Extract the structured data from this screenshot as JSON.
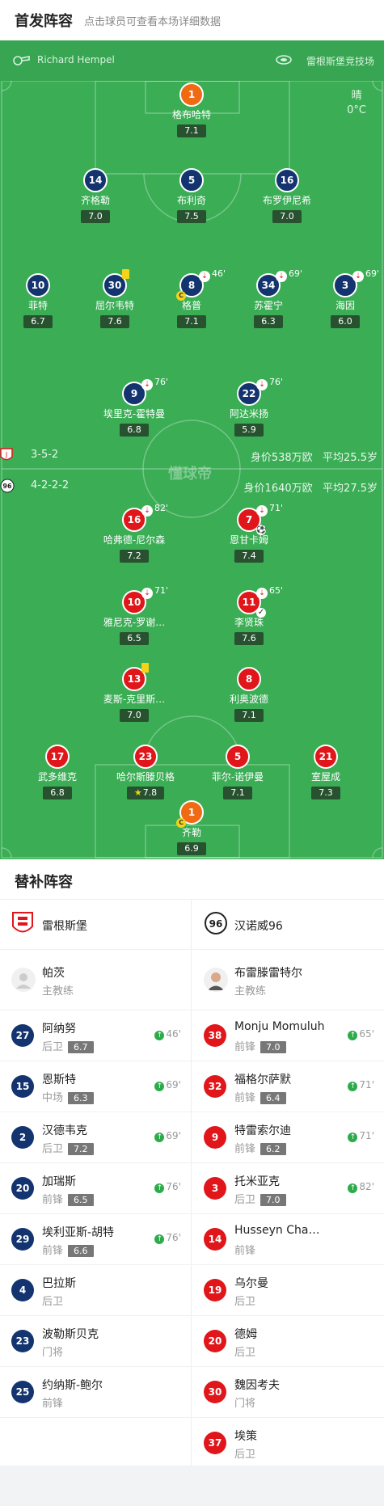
{
  "header": {
    "title": "首发阵容",
    "subtitle": "点击球员可查看本场详细数据"
  },
  "match": {
    "referee": "Richard Hempel",
    "venue": "雷根斯堡竞技场",
    "weather": "晴",
    "temperature": "0°C",
    "watermark": "懂球帝"
  },
  "home": {
    "formation": "3-5-2",
    "value": "身价538万欧",
    "avg_age": "平均25.5岁"
  },
  "away": {
    "formation": "4-2-2-2",
    "value": "身价1640万欧",
    "avg_age": "平均27.5岁"
  },
  "home_players": [
    {
      "num": "1",
      "name": "格布哈特",
      "rating": "7.1",
      "color": "orange"
    },
    {
      "num": "14",
      "name": "齐格勒",
      "rating": "7.0",
      "color": "blue"
    },
    {
      "num": "5",
      "name": "布利奇",
      "rating": "7.5",
      "color": "blue"
    },
    {
      "num": "16",
      "name": "布罗伊尼希",
      "rating": "7.0",
      "color": "blue"
    },
    {
      "num": "10",
      "name": "菲特",
      "rating": "6.7",
      "color": "blue"
    },
    {
      "num": "30",
      "name": "屈尔韦特",
      "rating": "7.6",
      "color": "blue",
      "yellow": true
    },
    {
      "num": "8",
      "name": "格普",
      "rating": "7.1",
      "color": "blue",
      "sub_out": "46'",
      "captain": "C"
    },
    {
      "num": "34",
      "name": "苏霍宁",
      "rating": "6.3",
      "color": "blue",
      "sub_out": "69'"
    },
    {
      "num": "3",
      "name": "海因",
      "rating": "6.0",
      "color": "blue",
      "sub_out": "69'"
    },
    {
      "num": "9",
      "name": "埃里克-霍特曼",
      "rating": "6.8",
      "color": "blue",
      "sub_out": "76'"
    },
    {
      "num": "22",
      "name": "阿达米扬",
      "rating": "5.9",
      "color": "blue",
      "sub_out": "76'"
    }
  ],
  "away_players": [
    {
      "num": "16",
      "name": "哈弗德-尼尔森",
      "rating": "7.2",
      "color": "red",
      "sub_out": "82'"
    },
    {
      "num": "7",
      "name": "恩甘卡姆",
      "rating": "7.4",
      "color": "red",
      "sub_out": "71'",
      "goal": true
    },
    {
      "num": "10",
      "name": "雅尼克-罗谢…",
      "rating": "6.5",
      "color": "red",
      "sub_out": "71'"
    },
    {
      "num": "11",
      "name": "李贤珠",
      "rating": "7.6",
      "color": "red",
      "sub_out": "65'",
      "assist": true
    },
    {
      "num": "13",
      "name": "麦斯-克里斯…",
      "rating": "7.0",
      "color": "red",
      "yellow": true
    },
    {
      "num": "8",
      "name": "利奥波德",
      "rating": "7.1",
      "color": "red"
    },
    {
      "num": "17",
      "name": "武多维克",
      "rating": "6.8",
      "color": "red"
    },
    {
      "num": "23",
      "name": "哈尔斯滕贝格",
      "rating": "7.8",
      "color": "red",
      "star": true
    },
    {
      "num": "5",
      "name": "菲尔-诺伊曼",
      "rating": "7.1",
      "color": "red"
    },
    {
      "num": "21",
      "name": "室屋成",
      "rating": "7.3",
      "color": "red"
    },
    {
      "num": "1",
      "name": "齐勒",
      "rating": "6.9",
      "color": "orange",
      "captain": "C"
    }
  ],
  "subs": {
    "title": "替补阵容",
    "home_team": "雷根斯堡",
    "away_team": "汉诺威96",
    "home_coach": {
      "name": "帕茨",
      "role": "主教练"
    },
    "away_coach": {
      "name": "布雷滕雷特尔",
      "role": "主教练"
    },
    "home": [
      {
        "num": "27",
        "name": "阿纳努",
        "pos": "后卫",
        "rating": "6.7",
        "time": "46'"
      },
      {
        "num": "15",
        "name": "恩斯特",
        "pos": "中场",
        "rating": "6.3",
        "time": "69'"
      },
      {
        "num": "2",
        "name": "汉德韦克",
        "pos": "后卫",
        "rating": "7.2",
        "time": "69'"
      },
      {
        "num": "20",
        "name": "加瑞斯",
        "pos": "前锋",
        "rating": "6.5",
        "time": "76'"
      },
      {
        "num": "29",
        "name": "埃利亚斯-胡特",
        "pos": "前锋",
        "rating": "6.6",
        "time": "76'"
      },
      {
        "num": "4",
        "name": "巴拉斯",
        "pos": "后卫"
      },
      {
        "num": "23",
        "name": "波勒斯贝克",
        "pos": "门将"
      },
      {
        "num": "25",
        "name": "约纳斯-鲍尔",
        "pos": "前锋"
      }
    ],
    "away": [
      {
        "num": "38",
        "name": "Monju Momuluh",
        "pos": "前锋",
        "rating": "7.0",
        "time": "65'"
      },
      {
        "num": "32",
        "name": "福格尔萨默",
        "pos": "前锋",
        "rating": "6.4",
        "time": "71'"
      },
      {
        "num": "9",
        "name": "特雷索尔迪",
        "pos": "前锋",
        "rating": "6.2",
        "time": "71'"
      },
      {
        "num": "3",
        "name": "托米亚克",
        "pos": "后卫",
        "rating": "7.0",
        "time": "82'"
      },
      {
        "num": "14",
        "name": "Husseyn Cha…",
        "pos": "前锋"
      },
      {
        "num": "19",
        "name": "乌尔曼",
        "pos": "后卫"
      },
      {
        "num": "20",
        "name": "德姆",
        "pos": "后卫"
      },
      {
        "num": "30",
        "name": "魏因考夫",
        "pos": "门将"
      },
      {
        "num": "37",
        "name": "埃策",
        "pos": "后卫"
      }
    ]
  },
  "colors": {
    "pitch": "#3aad55",
    "home_blue": "#14346f",
    "away_red": "#e0161b",
    "keeper": "#ef6a12",
    "sub_in": "#2dab4a"
  }
}
